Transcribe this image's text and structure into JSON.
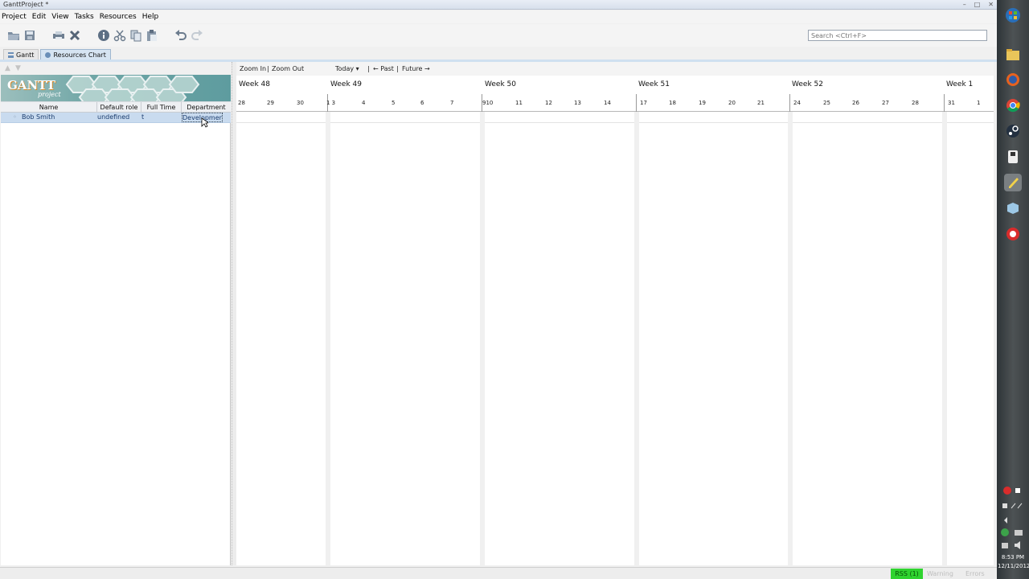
{
  "window": {
    "title": "GanttProject *",
    "minimize": "–",
    "maximize": "□",
    "close": "✕"
  },
  "menu": [
    "Project",
    "Edit",
    "View",
    "Tasks",
    "Resources",
    "Help"
  ],
  "search": {
    "placeholder": "Search <Ctrl+F>"
  },
  "tabs": {
    "gantt": "Gantt",
    "resources": "Resources Chart"
  },
  "logo": {
    "text": "GANTT",
    "sub": "project"
  },
  "resource_table": {
    "columns": [
      "Name",
      "Default role",
      "Full Time",
      "Department"
    ],
    "rows": [
      {
        "name": "Bob Smith",
        "role": "undefined",
        "full_time": "t",
        "department": "Development"
      }
    ]
  },
  "chart_controls": {
    "zoom_in": "Zoom In",
    "zoom_out": "Zoom Out",
    "separator": "|",
    "today": "Today ▾",
    "past": "← Past",
    "future": "Future →"
  },
  "weeks": [
    "Week 48",
    "Week 49",
    "Week 50",
    "Week 51",
    "Week 52",
    "Week 1"
  ],
  "days": [
    "28",
    "29",
    "30",
    "1 3",
    "4",
    "5",
    "6",
    "7",
    "910",
    "11",
    "12",
    "13",
    "14",
    "17",
    "18",
    "19",
    "20",
    "21",
    "24",
    "25",
    "26",
    "27",
    "28",
    "31",
    "1"
  ],
  "status": {
    "rss": "RSS (1)",
    "warning": "Warning",
    "errors": "Errors"
  },
  "clock": {
    "time": "8:53 PM",
    "date": "12/11/2012"
  },
  "colors": {
    "selection": "#c9dbef",
    "rss": "#2fd32f",
    "banner": "#5e9c9f"
  }
}
